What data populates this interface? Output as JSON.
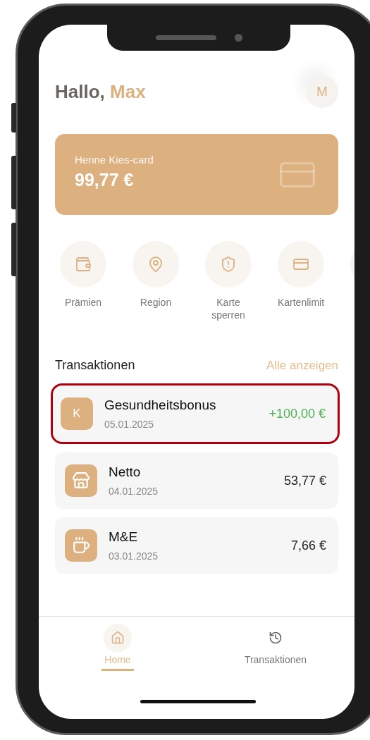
{
  "greeting": {
    "prefix": "Hallo,",
    "name": "Max"
  },
  "avatar": {
    "initial": "M"
  },
  "card": {
    "title": "Henne Kies-card",
    "balance": "99,77 €"
  },
  "quick_actions": [
    {
      "kind": "wallet",
      "label": "Prämien"
    },
    {
      "kind": "pin",
      "label": "Region"
    },
    {
      "kind": "shield",
      "label": "Karte sperren"
    },
    {
      "kind": "card",
      "label": "Kartenlimit"
    }
  ],
  "transactions": {
    "title": "Transaktionen",
    "link": "Alle anzeigen",
    "rows": [
      {
        "kind": "letter",
        "letter": "K",
        "name": "Gesundheitsbonus",
        "date": "05.01.2025",
        "amount": "+100,00 €",
        "credit": true,
        "highlighted": true
      },
      {
        "kind": "store",
        "name": "Netto",
        "date": "04.01.2025",
        "amount": "53,77 €",
        "credit": false,
        "highlighted": false
      },
      {
        "kind": "coffee",
        "name": "M&E",
        "date": "03.01.2025",
        "amount": "7,66 €",
        "credit": false,
        "highlighted": false
      }
    ]
  },
  "nav": [
    {
      "kind": "home",
      "label": "Home",
      "selected": true
    },
    {
      "kind": "history",
      "label": "Transaktionen",
      "selected": false
    }
  ]
}
